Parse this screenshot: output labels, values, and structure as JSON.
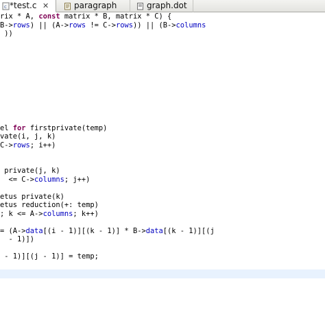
{
  "tabs": [
    {
      "label": "*test.c",
      "close": "✕"
    },
    {
      "label": "paragraph"
    },
    {
      "label": "graph.dot"
    }
  ],
  "code_lines": [
    [],
    [
      {
        "t": "rix * A, "
      },
      {
        "t": "const",
        "c": "kw"
      },
      {
        "t": " matrix * B, matrix * C) {"
      }
    ],
    [
      {
        "t": "B->"
      },
      {
        "t": "rows",
        "c": "fld"
      },
      {
        "t": ") || (A->"
      },
      {
        "t": "rows",
        "c": "fld"
      },
      {
        "t": " != C->"
      },
      {
        "t": "rows",
        "c": "fld"
      },
      {
        "t": ")) || (B->"
      },
      {
        "t": "columns",
        "c": "fld"
      }
    ],
    [
      {
        "t": " ))"
      }
    ],
    [],
    [],
    [],
    [],
    [],
    [],
    [],
    [],
    [],
    [],
    [
      {
        "t": "el "
      },
      {
        "t": "for",
        "c": "kw"
      },
      {
        "t": " firstprivate(temp)"
      }
    ],
    [
      {
        "t": "vate(i, j, k)"
      }
    ],
    [
      {
        "t": "C->"
      },
      {
        "t": "rows",
        "c": "fld"
      },
      {
        "t": "; i++)"
      }
    ],
    [],
    [],
    [
      {
        "t": " private(j, k)"
      }
    ],
    [
      {
        "t": "  <= C->"
      },
      {
        "t": "columns",
        "c": "fld"
      },
      {
        "t": "; j++)"
      }
    ],
    [],
    [
      {
        "t": "etus private(k)"
      }
    ],
    [
      {
        "t": "etus reduction(+: temp)"
      }
    ],
    [
      {
        "t": "; k <= A->"
      },
      {
        "t": "columns",
        "c": "fld"
      },
      {
        "t": "; k++)"
      }
    ],
    [],
    [
      {
        "t": "= (A->"
      },
      {
        "t": "data",
        "c": "fld"
      },
      {
        "t": "[(i - 1)][(k - 1)] * B->"
      },
      {
        "t": "data",
        "c": "fld"
      },
      {
        "t": "[(k - 1)][(j"
      }
    ],
    [
      {
        "t": "  - 1)])"
      }
    ],
    [],
    [
      {
        "t": " - 1)][(j - 1)] = temp;"
      }
    ],
    [],
    [],
    [],
    []
  ],
  "current_line": 31
}
